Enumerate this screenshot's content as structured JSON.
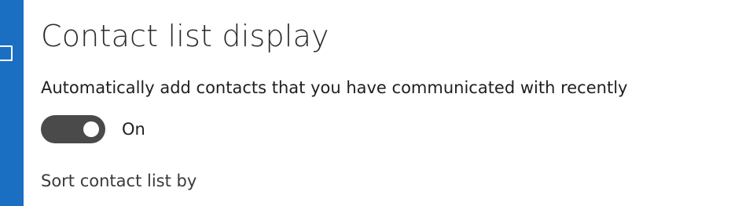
{
  "colors": {
    "rail": "#1a6fc2",
    "toggle_on_track": "#4a4a4a",
    "toggle_knob": "#ffffff"
  },
  "sidebar": {
    "icon": "square-outline-icon"
  },
  "section": {
    "title": "Contact list display"
  },
  "auto_add": {
    "label": "Automatically add contacts that you have communicated with recently",
    "toggle_state": "On",
    "enabled": true
  },
  "sort": {
    "label": "Sort contact list by"
  }
}
